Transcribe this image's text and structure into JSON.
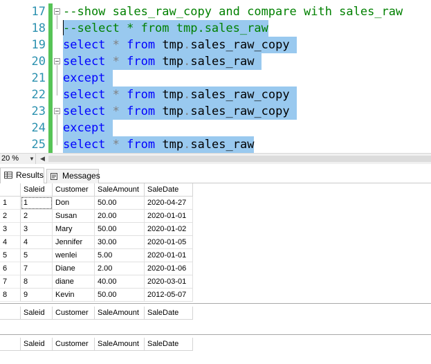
{
  "editor": {
    "lines": [
      {
        "num": "17",
        "fold": true,
        "tokens": [
          {
            "t": "--show sales_raw_copy and compare with sales_raw",
            "c": "cm"
          }
        ],
        "selected": false
      },
      {
        "num": "18",
        "fold": false,
        "tokens": [
          {
            "t": "--select * from tmp.sales_raw",
            "c": "cm"
          }
        ],
        "selected": true
      },
      {
        "num": "19",
        "fold": false,
        "tokens": [
          {
            "t": "select",
            "c": "kw"
          },
          {
            "t": " ",
            "c": "id"
          },
          {
            "t": "*",
            "c": "op"
          },
          {
            "t": " ",
            "c": "id"
          },
          {
            "t": "from",
            "c": "kw"
          },
          {
            "t": " tmp",
            "c": "id"
          },
          {
            "t": ".",
            "c": "op"
          },
          {
            "t": "sales_raw_copy",
            "c": "id"
          },
          {
            "t": " ",
            "c": "id"
          }
        ],
        "selected": true
      },
      {
        "num": "20",
        "fold": true,
        "tokens": [
          {
            "t": "select",
            "c": "kw"
          },
          {
            "t": " ",
            "c": "id"
          },
          {
            "t": "*",
            "c": "op"
          },
          {
            "t": " ",
            "c": "id"
          },
          {
            "t": "from",
            "c": "kw"
          },
          {
            "t": " tmp",
            "c": "id"
          },
          {
            "t": ".",
            "c": "op"
          },
          {
            "t": "sales_raw",
            "c": "id"
          },
          {
            "t": " ",
            "c": "id"
          }
        ],
        "selected": true
      },
      {
        "num": "21",
        "fold": false,
        "tokens": [
          {
            "t": "except",
            "c": "kw"
          },
          {
            "t": " ",
            "c": "id"
          }
        ],
        "selected": true
      },
      {
        "num": "22",
        "fold": false,
        "tokens": [
          {
            "t": "select",
            "c": "kw"
          },
          {
            "t": " ",
            "c": "id"
          },
          {
            "t": "*",
            "c": "op"
          },
          {
            "t": " ",
            "c": "id"
          },
          {
            "t": "from",
            "c": "kw"
          },
          {
            "t": " tmp",
            "c": "id"
          },
          {
            "t": ".",
            "c": "op"
          },
          {
            "t": "sales_raw_copy",
            "c": "id"
          },
          {
            "t": " ",
            "c": "id"
          }
        ],
        "selected": true
      },
      {
        "num": "23",
        "fold": true,
        "tokens": [
          {
            "t": "select",
            "c": "kw"
          },
          {
            "t": " ",
            "c": "id"
          },
          {
            "t": "*",
            "c": "op"
          },
          {
            "t": " ",
            "c": "id"
          },
          {
            "t": "from",
            "c": "kw"
          },
          {
            "t": " tmp",
            "c": "id"
          },
          {
            "t": ".",
            "c": "op"
          },
          {
            "t": "sales_raw_copy",
            "c": "id"
          },
          {
            "t": " ",
            "c": "id"
          }
        ],
        "selected": true
      },
      {
        "num": "24",
        "fold": false,
        "tokens": [
          {
            "t": "except",
            "c": "kw"
          },
          {
            "t": " ",
            "c": "id"
          }
        ],
        "selected": true
      },
      {
        "num": "25",
        "fold": false,
        "tokens": [
          {
            "t": "select",
            "c": "kw"
          },
          {
            "t": " ",
            "c": "id"
          },
          {
            "t": "*",
            "c": "op"
          },
          {
            "t": " ",
            "c": "id"
          },
          {
            "t": "from",
            "c": "kw"
          },
          {
            "t": " tmp",
            "c": "id"
          },
          {
            "t": ".",
            "c": "op"
          },
          {
            "t": "sales_raw",
            "c": "id"
          }
        ],
        "selected": true
      }
    ],
    "colors": {
      "keyword": "#0000ff",
      "comment": "#008000",
      "operator": "#808080",
      "selection": "#99c9ef",
      "linenumber": "#2b91af",
      "changebar": "#57c457"
    }
  },
  "statusbar": {
    "zoom": "20 %"
  },
  "tabs": {
    "results_label": "Results",
    "messages_label": "Messages"
  },
  "grids": [
    {
      "columns": [
        "Saleid",
        "Customer",
        "SaleAmount",
        "SaleDate"
      ],
      "rows": [
        {
          "rn": "1",
          "cells": [
            "1",
            "Don",
            "50.00",
            "2020-04-27"
          ]
        },
        {
          "rn": "2",
          "cells": [
            "2",
            "Susan",
            "20.00",
            "2020-01-01"
          ]
        },
        {
          "rn": "3",
          "cells": [
            "3",
            "Mary",
            "50.00",
            "2020-01-02"
          ]
        },
        {
          "rn": "4",
          "cells": [
            "4",
            "Jennifer",
            "30.00",
            "2020-01-05"
          ]
        },
        {
          "rn": "5",
          "cells": [
            "5",
            "wenlei",
            "5.00",
            "2020-01-01"
          ]
        },
        {
          "rn": "6",
          "cells": [
            "7",
            "Diane",
            "2.00",
            "2020-01-06"
          ]
        },
        {
          "rn": "7",
          "cells": [
            "8",
            "diane",
            "40.00",
            "2020-03-01"
          ]
        },
        {
          "rn": "8",
          "cells": [
            "9",
            "Kevin",
            "50.00",
            "2012-05-07"
          ]
        }
      ]
    },
    {
      "columns": [
        "Saleid",
        "Customer",
        "SaleAmount",
        "SaleDate"
      ],
      "rows": []
    },
    {
      "columns": [
        "Saleid",
        "Customer",
        "SaleAmount",
        "SaleDate"
      ],
      "rows": []
    }
  ]
}
